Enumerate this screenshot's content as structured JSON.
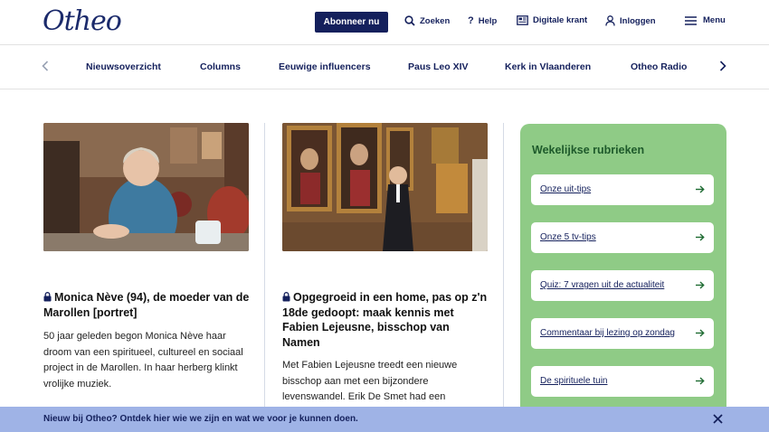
{
  "brand": {
    "logo_text": "Otheo"
  },
  "header": {
    "subscribe_label": "Abonneer nu",
    "search_label": "Zoeken",
    "help_label": "Help",
    "paper_label": "Digitale krant",
    "login_label": "Inloggen",
    "menu_label": "Menu"
  },
  "subnav": {
    "items": [
      "Nieuwsoverzicht",
      "Columns",
      "Eeuwige influencers",
      "Paus Leo XIV",
      "Kerk in Vlaanderen",
      "Otheo Radio"
    ]
  },
  "articles": [
    {
      "title": "Monica Nève (94), de moeder van de Marollen [portret]",
      "text": "50 jaar geleden begon Monica Nève haar droom van een spiritueel, cultureel en sociaal project in de Marollen. In haar herberg klinkt vrolijke muziek."
    },
    {
      "title": "Opgegroeid in een home, pas op z'n 18de gedoopt: maak kennis met Fabien Lejeusne, bisschop van Namen",
      "text": "Met Fabien Lejeusne treedt een nieuwe bisschop aan met een bijzondere levenswandel. Erik De Smet had een"
    }
  ],
  "sidebar": {
    "title": "Wekelijkse rubrieken",
    "items": [
      "Onze uit-tips",
      "Onze 5 tv-tips",
      "Quiz: 7 vragen uit de actualiteit",
      "Commentaar bij lezing op zondag",
      "De spirituele tuin"
    ]
  },
  "banner": {
    "text": "Nieuw bij Otheo? Ontdek hier wie we zijn en wat we voor je kunnen doen."
  },
  "colors": {
    "navy": "#14205c",
    "sidebar_green": "#8fcb86",
    "banner_blue": "#9fb3e6"
  },
  "icons": [
    "search-icon",
    "help-icon",
    "newspaper-icon",
    "user-icon",
    "menu-icon",
    "chevron-left-icon",
    "chevron-right-icon",
    "lock-icon",
    "arrow-right-icon",
    "close-icon"
  ]
}
